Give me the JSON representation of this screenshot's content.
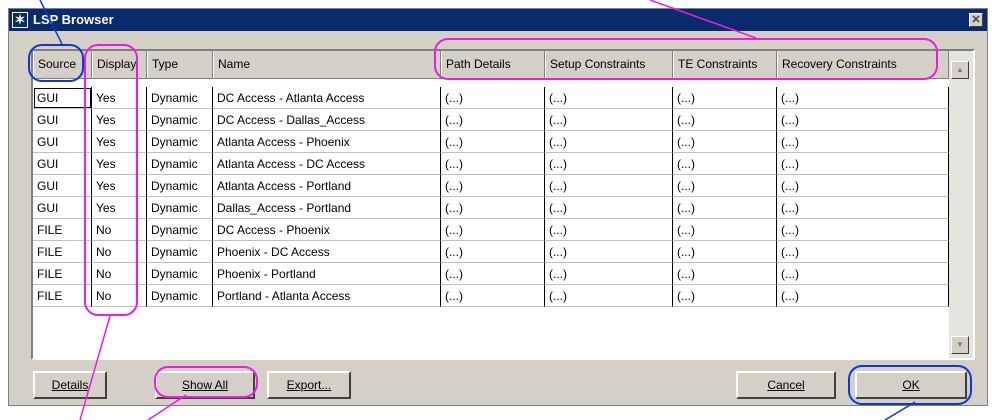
{
  "window": {
    "title": "LSP Browser",
    "title_icon": "star-icon",
    "close_icon": "close-icon"
  },
  "table": {
    "columns": [
      "Source",
      "Display",
      "Type",
      "Name",
      "Path Details",
      "Setup Constraints",
      "TE Constraints",
      "Recovery Constraints"
    ],
    "rows": [
      [
        "GUI",
        "Yes",
        "Dynamic",
        "DC Access - Atlanta Access",
        "(...)",
        "(...)",
        "(...)",
        "(...)"
      ],
      [
        "GUI",
        "Yes",
        "Dynamic",
        "DC Access - Dallas_Access",
        "(...)",
        "(...)",
        "(...)",
        "(...)"
      ],
      [
        "GUI",
        "Yes",
        "Dynamic",
        "Atlanta Access - Phoenix",
        "(...)",
        "(...)",
        "(...)",
        "(...)"
      ],
      [
        "GUI",
        "Yes",
        "Dynamic",
        "Atlanta Access - DC Access",
        "(...)",
        "(...)",
        "(...)",
        "(...)"
      ],
      [
        "GUI",
        "Yes",
        "Dynamic",
        "Atlanta Access - Portland",
        "(...)",
        "(...)",
        "(...)",
        "(...)"
      ],
      [
        "GUI",
        "Yes",
        "Dynamic",
        "Dallas_Access - Portland",
        "(...)",
        "(...)",
        "(...)",
        "(...)"
      ],
      [
        "FILE",
        "No",
        "Dynamic",
        "DC Access - Phoenix",
        "(...)",
        "(...)",
        "(...)",
        "(...)"
      ],
      [
        "FILE",
        "No",
        "Dynamic",
        "Phoenix - DC Access",
        "(...)",
        "(...)",
        "(...)",
        "(...)"
      ],
      [
        "FILE",
        "No",
        "Dynamic",
        "Phoenix - Portland",
        "(...)",
        "(...)",
        "(...)",
        "(...)"
      ],
      [
        "FILE",
        "No",
        "Dynamic",
        "Portland - Atlanta Access",
        "(...)",
        "(...)",
        "(...)",
        "(...)"
      ]
    ]
  },
  "buttons": {
    "details": "Details",
    "show_all": "Show All",
    "export": "Export...",
    "cancel": "Cancel",
    "ok": "OK"
  },
  "colors": {
    "annotation_magenta": "#e81ee0",
    "annotation_blue": "#1038d0",
    "titlebar": "#0a2a6e"
  }
}
